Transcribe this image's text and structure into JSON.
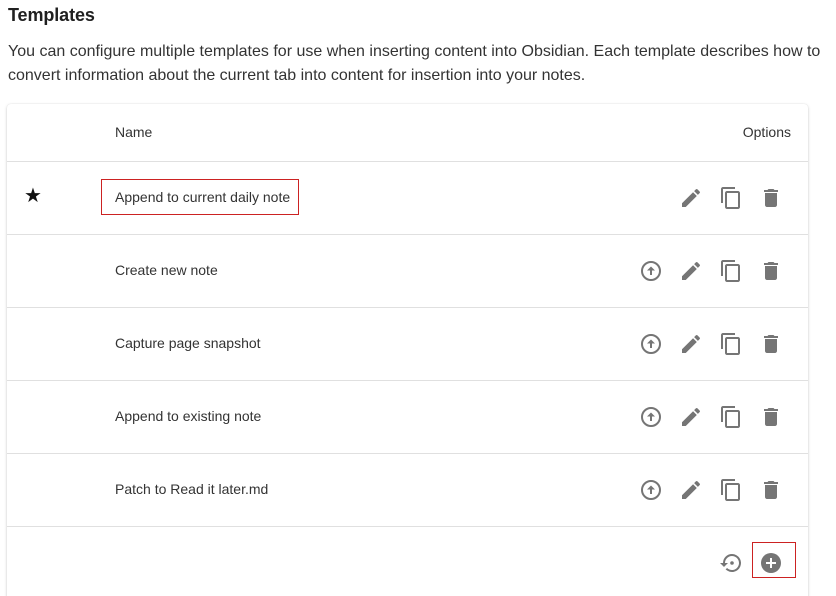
{
  "section": {
    "title": "Templates",
    "description": "You can configure multiple templates for use when inserting content into Obsidian. Each template describes how to convert information about the current tab into content for insertion into your notes."
  },
  "table": {
    "headers": {
      "name": "Name",
      "options": "Options"
    },
    "rows": [
      {
        "name": "Append to current daily note",
        "is_default": true,
        "default_marker": "★"
      },
      {
        "name": "Create new note",
        "is_default": false
      },
      {
        "name": "Capture page snapshot",
        "is_default": false
      },
      {
        "name": "Append to existing note",
        "is_default": false
      },
      {
        "name": "Patch to Read it later.md",
        "is_default": false
      }
    ]
  },
  "icons": {
    "set_default": "arrow-up-circle-icon",
    "edit": "pencil-icon",
    "duplicate": "copy-icon",
    "delete": "trash-icon",
    "restore": "restore-icon",
    "add": "add-circle-icon"
  },
  "colors": {
    "icon": "#757575",
    "highlight_border": "#cc2222",
    "divider": "#e0e0e0"
  }
}
